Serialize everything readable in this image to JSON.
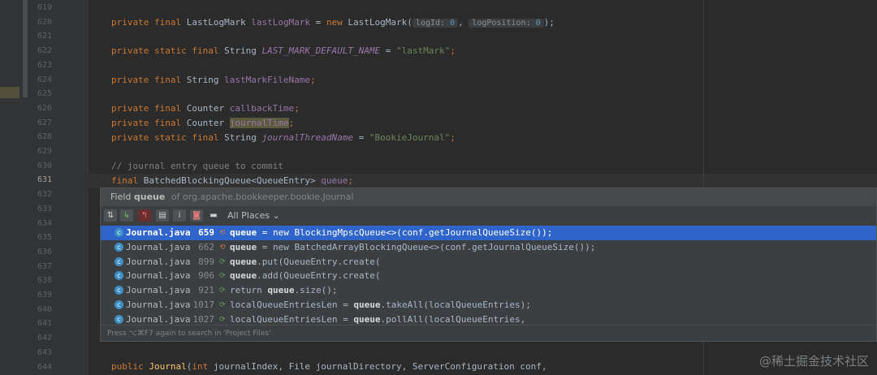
{
  "gutter": {
    "line_numbers": [
      "619",
      "620",
      "621",
      "622",
      "623",
      "624",
      "625",
      "626",
      "627",
      "628",
      "629",
      "630",
      "631",
      "632",
      "633",
      "634",
      "635",
      "636",
      "637",
      "638",
      "639",
      "640",
      "641",
      "642",
      "643",
      "644"
    ],
    "current_line": "631"
  },
  "code": {
    "l620": {
      "kw": "private final ",
      "type": "LastLogMark ",
      "field": "lastLogMark",
      "eq": " = ",
      "new": "new ",
      "ctor": "LastLogMark(",
      "hint1": "logId:",
      "v1": " 0",
      "comma": ", ",
      "hint2": "logPosition:",
      "v2": " 0",
      "end": ");"
    },
    "l622": {
      "kw": "private static final ",
      "type": "String ",
      "field": "LAST_MARK_DEFAULT_NAME",
      "eq": " = ",
      "str": "\"lastMark\"",
      "end": ";"
    },
    "l624": {
      "kw": "private final ",
      "type": "String ",
      "field": "lastMarkFileName",
      "end": ";"
    },
    "l626": {
      "kw": "private final ",
      "type": "Counter ",
      "field": "callbackTime",
      "end": ";"
    },
    "l627": {
      "kw": "private final ",
      "type": "Counter ",
      "field": "journalTime",
      "end": ";"
    },
    "l628": {
      "kw": "private static final ",
      "type": "String ",
      "field": "journalThreadName",
      "eq": " = ",
      "str": "\"BookieJournal\"",
      "end": ";"
    },
    "l630": {
      "comment": "// journal entry queue to commit"
    },
    "l631": {
      "kw": "final ",
      "type": "BatchedBlockingQueue<QueueEntry> ",
      "field": "queue",
      "end": ";"
    },
    "l644": {
      "kw": "public ",
      "name": "Journal",
      "open": "(",
      "t1": "int ",
      "p1": "journalIndex, ",
      "t2": "File ",
      "p2": "journalDirectory, ",
      "t3": "ServerConfiguration ",
      "p3": "conf,"
    }
  },
  "popup": {
    "title_prefix": "Field ",
    "title_name": "queue",
    "title_of": " of ",
    "title_class": "org.apache.bookkeeper.bookie.Journal",
    "toolbar_icons": [
      "collapse-all-icon",
      "import-icon",
      "export-icon",
      "group-by-file-icon",
      "info-icon",
      "preview-icon",
      "pin-icon"
    ],
    "scope": "All Places",
    "scope_arrow": "⌄",
    "footer": "Press ⌥⌘F7 again to search in 'Project Files'",
    "results": [
      {
        "file": "Journal.java",
        "line": "659",
        "access": "write",
        "pre": "",
        "bold": "queue",
        "post": " = new BlockingMpscQueue<>(conf.getJournalQueueSize());"
      },
      {
        "file": "Journal.java",
        "line": "662",
        "access": "write",
        "pre": "",
        "bold": "queue",
        "post": " = new BatchedArrayBlockingQueue<>(conf.getJournalQueueSize());"
      },
      {
        "file": "Journal.java",
        "line": "899",
        "access": "read",
        "pre": "",
        "bold": "queue",
        "post": ".put(QueueEntry.create("
      },
      {
        "file": "Journal.java",
        "line": "906",
        "access": "read",
        "pre": "",
        "bold": "queue",
        "post": ".add(QueueEntry.create("
      },
      {
        "file": "Journal.java",
        "line": "921",
        "access": "read",
        "pre": "return ",
        "bold": "queue",
        "post": ".size();"
      },
      {
        "file": "Journal.java",
        "line": "1017",
        "access": "read",
        "pre": "localQueueEntriesLen = ",
        "bold": "queue",
        "post": ".takeAll(localQueueEntries);"
      },
      {
        "file": "Journal.java",
        "line": "1027",
        "access": "read",
        "pre": "localQueueEntriesLen = ",
        "bold": "queue",
        "post": ".pollAll(localQueueEntries,"
      }
    ]
  },
  "watermark": "@稀土掘金技术社区",
  "colors": {
    "keyword": "#cc7832",
    "field": "#9876aa",
    "string": "#6a8759",
    "selection": "#2f65ca",
    "class_icon": "#3d8fc5"
  }
}
